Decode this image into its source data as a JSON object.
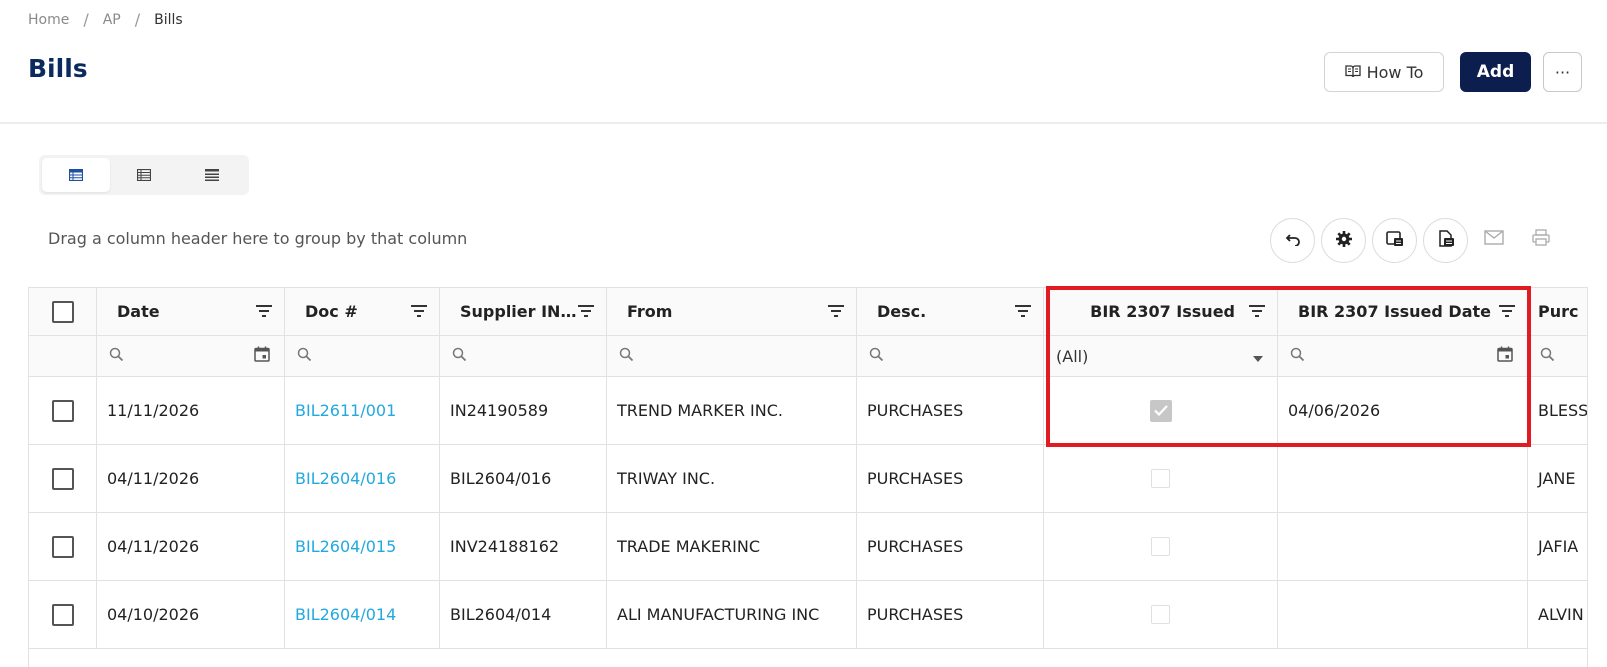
{
  "breadcrumb": {
    "home": "Home",
    "ap": "AP",
    "current": "Bills",
    "separator": "/"
  },
  "page": {
    "title": "Bills"
  },
  "toolbar": {
    "howto_label": "How To",
    "add_label": "Add",
    "more_label": "···"
  },
  "grid_toolbar": {
    "group_hint": "Drag a column header here to group by that column"
  },
  "columns": [
    {
      "key": "date",
      "label": "Date"
    },
    {
      "key": "doc",
      "label": "Doc #"
    },
    {
      "key": "supplier_inv",
      "label": "Supplier IN..."
    },
    {
      "key": "from",
      "label": "From"
    },
    {
      "key": "desc",
      "label": "Desc."
    },
    {
      "key": "bir_issued",
      "label": "BIR 2307 Issued"
    },
    {
      "key": "bir_date",
      "label": "BIR 2307 Issued Date"
    },
    {
      "key": "purchaser",
      "label": "Purc"
    }
  ],
  "filters": {
    "bir_issued_select": "(All)"
  },
  "rows": [
    {
      "date": "11/11/2026",
      "doc": "BIL2611/001",
      "supplier_inv": "IN24190589",
      "from": "TREND MARKER INC.",
      "desc": "PURCHASES",
      "bir_issued": true,
      "bir_date": "04/06/2026",
      "purchaser": "BLESS"
    },
    {
      "date": "04/11/2026",
      "doc": "BIL2604/016",
      "supplier_inv": "BIL2604/016",
      "from": "TRIWAY INC.",
      "desc": "PURCHASES",
      "bir_issued": false,
      "bir_date": "",
      "purchaser": "JANE"
    },
    {
      "date": "04/11/2026",
      "doc": "BIL2604/015",
      "supplier_inv": "INV24188162",
      "from": "TRADE MAKERINC",
      "desc": "PURCHASES",
      "bir_issued": false,
      "bir_date": "",
      "purchaser": "JAFIA"
    },
    {
      "date": "04/10/2026",
      "doc": "BIL2604/014",
      "supplier_inv": "BIL2604/014",
      "from": "ALI MANUFACTURING INC",
      "desc": "PURCHASES",
      "bir_issued": false,
      "bir_date": "",
      "purchaser": "ALVIN"
    }
  ],
  "colors": {
    "title": "#0b2a5e",
    "primary": "#0b1e4d",
    "link": "#23a8e0",
    "highlight": "#e01b22"
  }
}
